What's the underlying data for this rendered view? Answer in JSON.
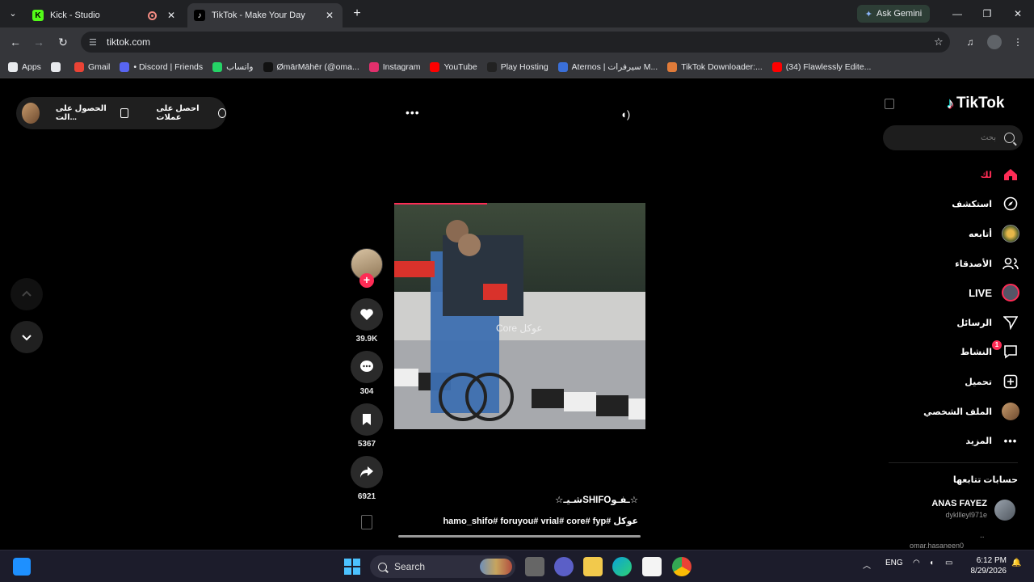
{
  "browser": {
    "tabs": [
      {
        "title": "Kick - Studio",
        "active": false
      },
      {
        "title": "TikTok - Make Your Day",
        "active": true
      }
    ],
    "gemini_label": "Ask Gemini",
    "url": "tiktok.com",
    "bookmarks": [
      {
        "label": "Apps",
        "icon": "apps-grid-icon",
        "color": "#e8eaed"
      },
      {
        "label": "",
        "icon": "grid-icon",
        "color": "#e8eaed"
      },
      {
        "label": "Gmail",
        "icon": "gmail-icon",
        "color": "#ea4335"
      },
      {
        "label": "• Discord | Friends",
        "icon": "discord-icon",
        "color": "#5865f2"
      },
      {
        "label": "واتساب",
        "icon": "whatsapp-icon",
        "color": "#25d366"
      },
      {
        "label": "ØmārMāhēr (@oma...",
        "icon": "tiktok-icon",
        "color": "#111111"
      },
      {
        "label": "Instagram",
        "icon": "instagram-icon",
        "color": "#e1306c"
      },
      {
        "label": "YouTube",
        "icon": "youtube-icon",
        "color": "#ff0000"
      },
      {
        "label": "Play Hosting",
        "icon": "play-hosting-icon",
        "color": "#222222"
      },
      {
        "label": "Aternos | سيرفرات M...",
        "icon": "aternos-icon",
        "color": "#3a6fd8"
      },
      {
        "label": "TikTok Downloader:...",
        "icon": "downloader-icon",
        "color": "#e07b39"
      },
      {
        "label": "(34) Flawlessly Edite...",
        "icon": "youtube-icon",
        "color": "#ff0000"
      }
    ]
  },
  "tiktok": {
    "promo": {
      "text1": "احصل على عملات",
      "text2": "الحصول على الت..."
    },
    "logo": "TikTok",
    "search_placeholder": "بحث",
    "nav": [
      {
        "label": "لك",
        "icon": "home-icon",
        "active": true
      },
      {
        "label": "استكشف",
        "icon": "compass-icon",
        "active": false
      },
      {
        "label": "أتابعه",
        "icon": "following-avatar-icon",
        "active": false
      },
      {
        "label": "الأصدقاء",
        "icon": "friends-icon",
        "active": false
      },
      {
        "label": "LIVE",
        "icon": "live-avatar-icon",
        "active": false
      },
      {
        "label": "الرسائل",
        "icon": "send-icon",
        "active": false
      },
      {
        "label": "النشاط",
        "icon": "activity-icon",
        "active": false,
        "badge": "1"
      },
      {
        "label": "تحميل",
        "icon": "upload-icon",
        "active": false
      },
      {
        "label": "الملف الشخصي",
        "icon": "profile-avatar-icon",
        "active": false
      },
      {
        "label": "المزيد",
        "icon": "more-icon",
        "active": false
      }
    ],
    "following_title": "حسابات تتابعها",
    "following": [
      {
        "name": "ANAS FAYEZ",
        "username": "dykllleyl971e"
      },
      {
        "name": "",
        "username": "omar.hasaneen0"
      }
    ],
    "video": {
      "watermark": "Core عوكل",
      "title": "☆شـيـSHIFOـفـو☆",
      "tags": "hamo_shifo# foruyou# vrial# core# fyp# عوكل",
      "likes": "39.9K",
      "comments": "304",
      "saves": "5367",
      "shares": "6921"
    }
  },
  "taskbar": {
    "search_label": "Search",
    "lang": "ENG",
    "time": "6:12 PM",
    "date": "8/29/2026"
  },
  "colors": {
    "accent": "#fe2c55",
    "tiktok_cyan": "#25f4ee"
  }
}
